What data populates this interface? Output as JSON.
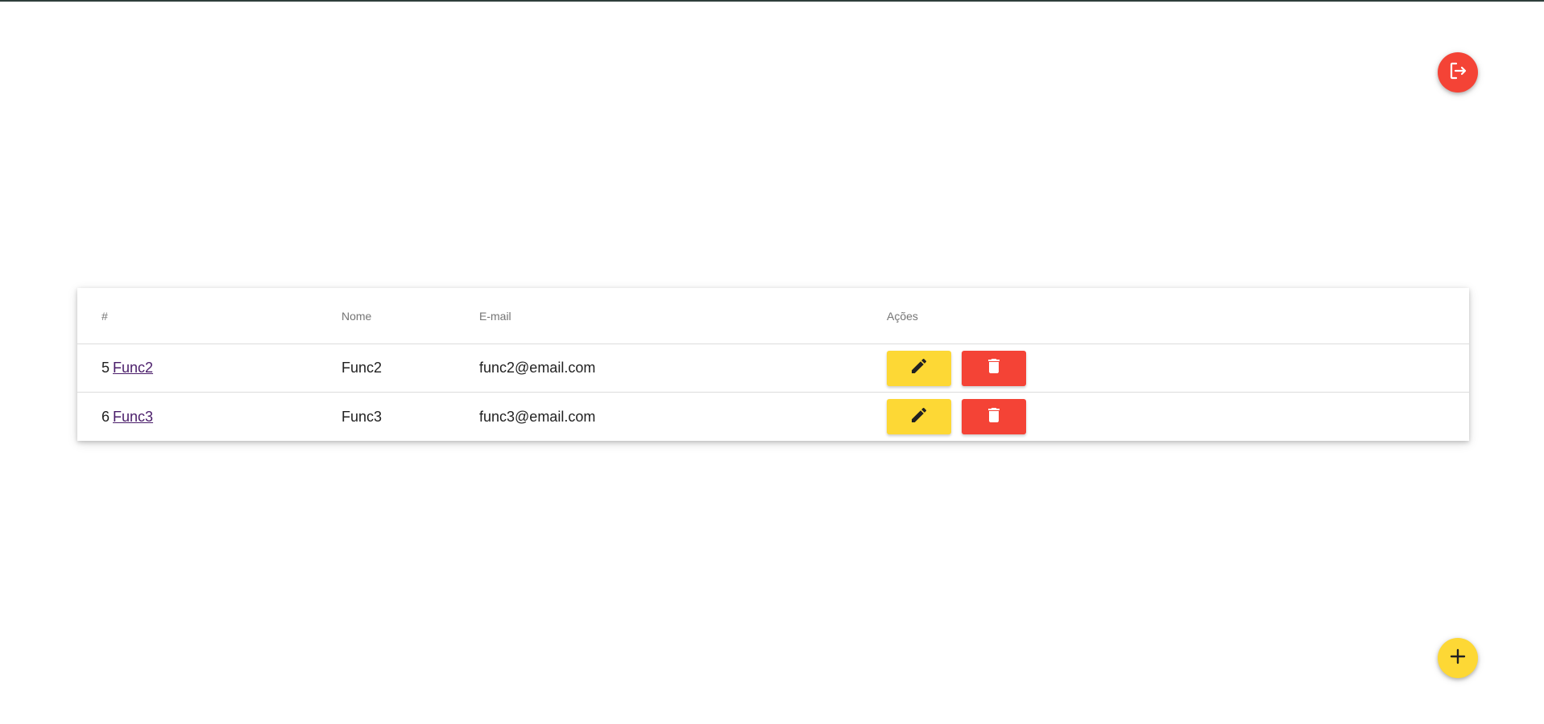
{
  "header_actions": {
    "logout_icon": "logout-icon",
    "logout_color": "#f44336"
  },
  "table": {
    "columns": [
      "#",
      "Nome",
      "E-mail",
      "Ações"
    ],
    "rows": [
      {
        "id": "5",
        "link": "Func2",
        "name": "Func2",
        "email": "func2@email.com"
      },
      {
        "id": "6",
        "link": "Func3",
        "name": "Func3",
        "email": "func3@email.com"
      }
    ],
    "edit_icon": "pencil-icon",
    "delete_icon": "trash-icon",
    "edit_color": "#fdd835",
    "delete_color": "#f44336"
  },
  "fab": {
    "add_icon": "plus-icon",
    "add_color": "#fdd835"
  }
}
